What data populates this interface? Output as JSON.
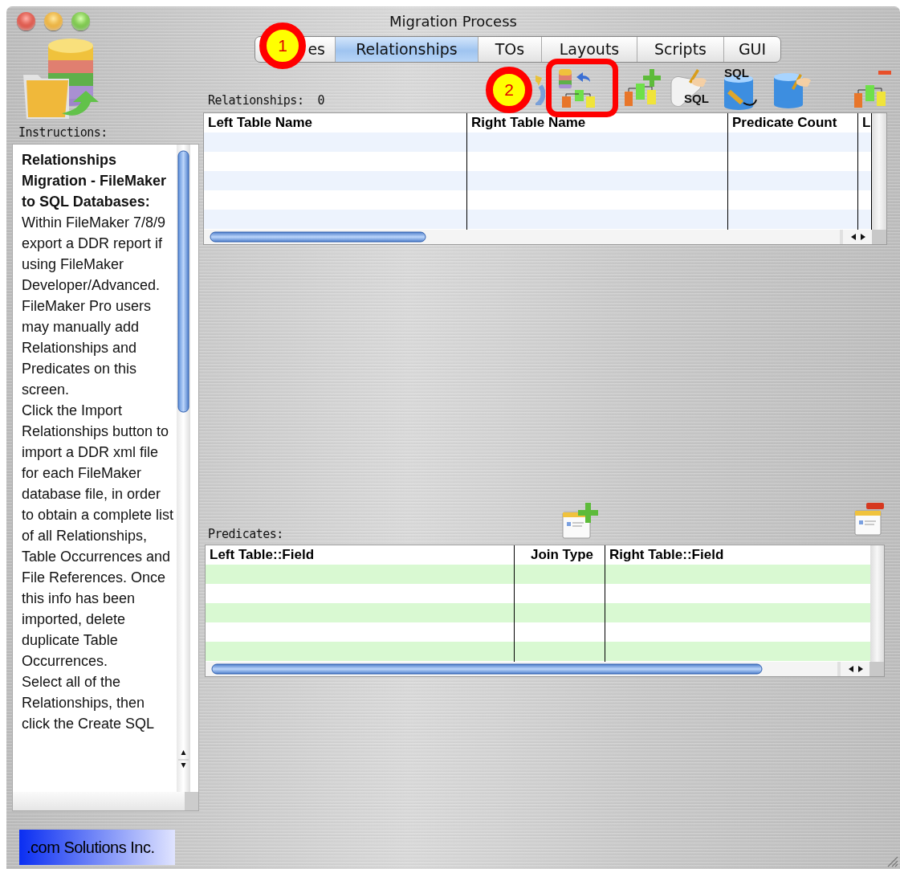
{
  "window": {
    "title": "Migration Process"
  },
  "tabs": [
    {
      "label": "es",
      "selected": false
    },
    {
      "label": "Relationships",
      "selected": true
    },
    {
      "label": "TOs",
      "selected": false
    },
    {
      "label": "Layouts",
      "selected": false
    },
    {
      "label": "Scripts",
      "selected": false
    },
    {
      "label": "GUI",
      "selected": false
    }
  ],
  "instructions": {
    "label": "Instructions:",
    "heading": "Relationships Migration - FileMaker to SQL Databases:",
    "paragraphs": [
      "Within FileMaker 7/8/9 export a DDR report if using FileMaker Developer/Advanced. FileMaker Pro users may manually add Relationships and Predicates on this screen.",
      "Click the Import Relationships button to import a DDR xml file for each FileMaker database file, in order to obtain a complete list of all Relationships, Table Occurrences and File References. Once this info has been imported, delete duplicate Table Occurrences.",
      "Select all of the Relationships, then click the Create SQL"
    ]
  },
  "relationships": {
    "label": "Relationships:",
    "count": "0",
    "toolbar": [
      {
        "kind": "cycle"
      },
      {
        "kind": "import"
      },
      {
        "kind": "add"
      },
      {
        "kind": "script_sql",
        "text": "SQL"
      },
      {
        "kind": "db_sql",
        "text": "SQL"
      },
      {
        "kind": "db_edit"
      },
      {
        "kind": "remove"
      }
    ],
    "columns": [
      "Left Table Name",
      "Right Table Name",
      "Predicate Count",
      "L"
    ]
  },
  "predicates": {
    "label": "Predicates:",
    "toolbar": [
      {
        "kind": "card_add"
      },
      {
        "kind": "card_remove"
      }
    ],
    "columns": [
      "Left Table::Field",
      "Join Type",
      "Right Table::Field"
    ]
  },
  "callouts": [
    {
      "label": "1"
    },
    {
      "label": "2"
    }
  ],
  "footer": {
    "company": ".com Solutions Inc."
  }
}
